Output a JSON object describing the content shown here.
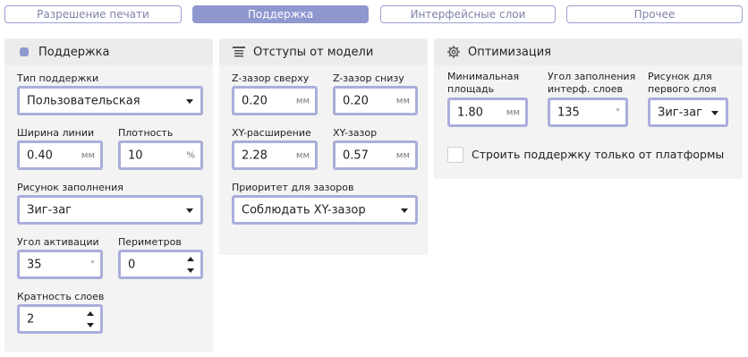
{
  "tabs": [
    {
      "label": "Разрешение печати",
      "active": false
    },
    {
      "label": "Поддержка",
      "active": true
    },
    {
      "label": "Интерфейсные слои",
      "active": false
    },
    {
      "label": "Прочее",
      "active": false
    }
  ],
  "support": {
    "title": "Поддержка",
    "icon": "square-icon",
    "type_label": "Тип поддержки",
    "type_value": "Пользовательская",
    "line_width_label": "Ширина линии",
    "line_width_value": "0.40",
    "line_width_unit": "мм",
    "density_label": "Плотность",
    "density_value": "10",
    "density_unit": "%",
    "pattern_label": "Рисунок заполнения",
    "pattern_value": "Зиг-заг",
    "angle_label": "Угол активации",
    "angle_value": "35",
    "angle_unit": "°",
    "perimeters_label": "Периметров",
    "perimeters_value": "0",
    "layer_mult_label": "Кратность слоев",
    "layer_mult_value": "2"
  },
  "offsets": {
    "title": "Отступы от модели",
    "icon": "document-lines-icon",
    "z_top_label": "Z-зазор сверху",
    "z_top_value": "0.20",
    "z_top_unit": "мм",
    "z_bottom_label": "Z-зазор снизу",
    "z_bottom_value": "0.20",
    "z_bottom_unit": "мм",
    "xy_expand_label": "XY-расширение",
    "xy_expand_value": "2.28",
    "xy_expand_unit": "мм",
    "xy_gap_label": "XY-зазор",
    "xy_gap_value": "0.57",
    "xy_gap_unit": "мм",
    "priority_label": "Приоритет для зазоров",
    "priority_value": "Соблюдать XY-зазор"
  },
  "optimization": {
    "title": "Оптимизация",
    "icon": "gear-icon",
    "min_area_label_1": "Минимальная",
    "min_area_label_2": "площадь",
    "min_area_value": "1.80",
    "min_area_unit": "мм",
    "iface_angle_label_1": "Угол заполнения",
    "iface_angle_label_2": "интерф. слоев",
    "iface_angle_value": "135",
    "iface_angle_unit": "°",
    "first_layer_label_1": "Рисунок для",
    "first_layer_label_2": "первого слоя",
    "first_layer_value": "Зиг-заг",
    "platform_only_label": "Строить поддержку только от платформы",
    "platform_only_checked": false
  },
  "colors": {
    "accent": "#8f97cf",
    "field_border": "#a9aedb",
    "panel_bg": "#ececec",
    "panel_body_bg": "#f3f3f3"
  }
}
